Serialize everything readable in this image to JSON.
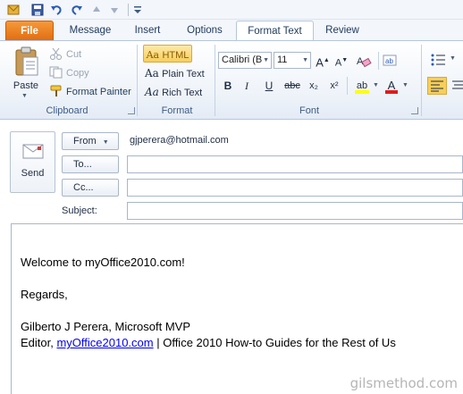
{
  "quick_access": {
    "icons": [
      "outlook-icon",
      "save-icon",
      "undo-icon",
      "redo-icon",
      "up-arrow-icon",
      "down-arrow-icon",
      "customize-icon"
    ]
  },
  "tabs": [
    {
      "label": "File"
    },
    {
      "label": "Message"
    },
    {
      "label": "Insert"
    },
    {
      "label": "Options"
    },
    {
      "label": "Format Text"
    },
    {
      "label": "Review"
    }
  ],
  "ribbon": {
    "clipboard": {
      "label": "Clipboard",
      "paste": "Paste",
      "cut": "Cut",
      "copy": "Copy",
      "format_painter": "Format Painter"
    },
    "format": {
      "label": "Format",
      "html": "HTML",
      "plain_text": "Plain Text",
      "rich_text": "Rich Text",
      "glyph": "Aa"
    },
    "font": {
      "label": "Font",
      "font_name": "Calibri (B",
      "font_size": "11",
      "bold": "B",
      "italic": "I",
      "underline": "U",
      "strikethrough": "abc",
      "subscript": "x₂",
      "superscript": "x²",
      "grow": "A",
      "shrink": "A",
      "font_color": "A",
      "highlight": "ab"
    }
  },
  "header": {
    "send_label": "Send",
    "from_label": "From",
    "from_address": "gjperera@hotmail.com",
    "to_label": "To...",
    "cc_label": "Cc...",
    "subject_label": "Subject:",
    "to_value": "",
    "cc_value": "",
    "subject_value": ""
  },
  "body": {
    "line1": "Welcome to myOffice2010.com!",
    "line2": "Regards,",
    "line3": "Gilberto J Perera, Microsoft MVP",
    "line4_prefix": "Editor, ",
    "line4_link": "myOffice2010.com",
    "line4_suffix": " | Office 2010 How-to Guides for the Rest of Us"
  },
  "watermark": "gilsmethod.com",
  "colors": {
    "file_tab": "#e06b10",
    "accent": "#1e395b",
    "highlight_selected": "#f8ce5b",
    "link": "#0000ee"
  }
}
